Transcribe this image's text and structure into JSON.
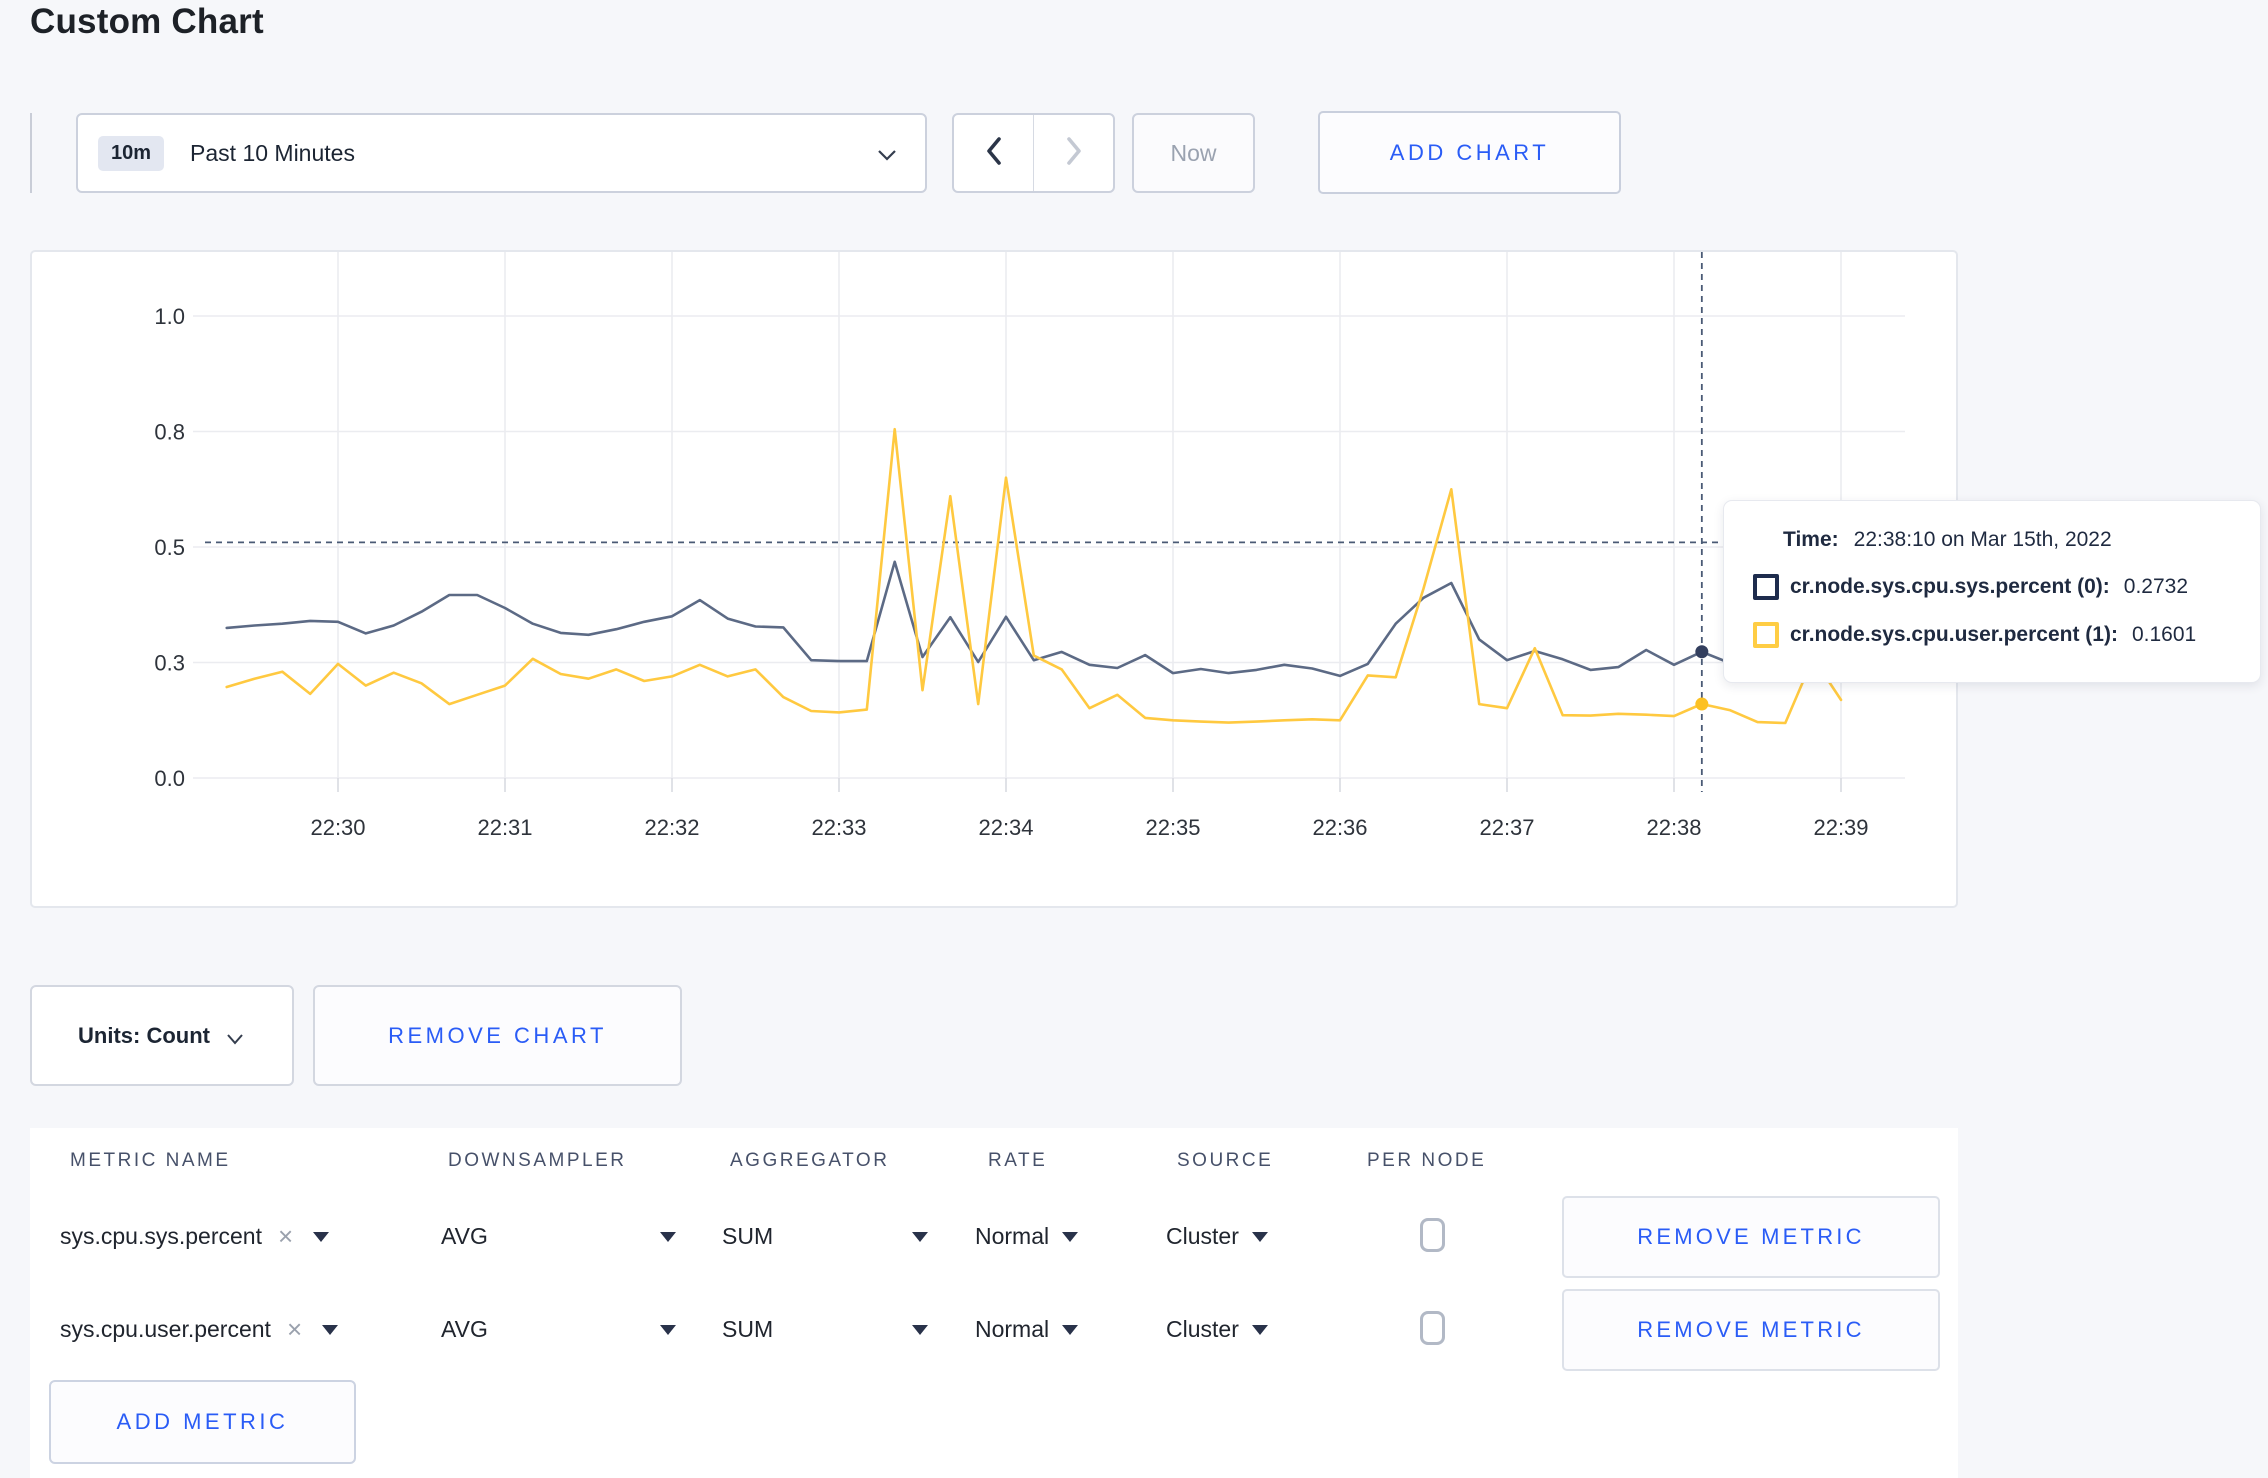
{
  "page": {
    "title": "Custom Chart"
  },
  "toolbar": {
    "time_window_badge": "10m",
    "time_window_label": "Past 10 Minutes",
    "now_label": "Now",
    "add_chart_label": "ADD CHART"
  },
  "chart_controls": {
    "units_label": "Units: Count",
    "remove_chart_label": "REMOVE CHART",
    "add_metric_label": "ADD METRIC"
  },
  "tooltip": {
    "time_label": "Time:",
    "time_value": "22:38:10 on Mar 15th, 2022",
    "series": [
      {
        "label": "cr.node.sys.cpu.sys.percent (0):",
        "value": "0.2732",
        "color": "#1e2c4d"
      },
      {
        "label": "cr.node.sys.cpu.user.percent (1):",
        "value": "0.1601",
        "color": "#ffcd44"
      }
    ]
  },
  "metrics_table": {
    "headers": [
      "METRIC NAME",
      "DOWNSAMPLER",
      "AGGREGATOR",
      "RATE",
      "SOURCE",
      "PER NODE"
    ],
    "rows": [
      {
        "metric": "sys.cpu.sys.percent",
        "remove_token": "×",
        "downsampler": "AVG",
        "aggregator": "SUM",
        "rate": "Normal",
        "source": "Cluster",
        "per_node_checked": false,
        "remove_label": "REMOVE METRIC"
      },
      {
        "metric": "sys.cpu.user.percent",
        "remove_token": "×",
        "downsampler": "AVG",
        "aggregator": "SUM",
        "rate": "Normal",
        "source": "Cluster",
        "per_node_checked": false,
        "remove_label": "REMOVE METRIC"
      }
    ]
  },
  "chart_data": {
    "type": "line",
    "title": "",
    "xlabel": "",
    "ylabel": "",
    "ylim": [
      0,
      1
    ],
    "grid": true,
    "x_start": "22:29:20",
    "x_step_seconds": 10,
    "x_ticks": [
      "22:30",
      "22:31",
      "22:32",
      "22:33",
      "22:34",
      "22:35",
      "22:36",
      "22:37",
      "22:38",
      "22:39"
    ],
    "y_ticks": [
      {
        "v": 0.0,
        "label": "0.0"
      },
      {
        "v": 0.25,
        "label": "0.3"
      },
      {
        "v": 0.5,
        "label": "0.5"
      },
      {
        "v": 0.75,
        "label": "0.8"
      },
      {
        "v": 1.0,
        "label": "1.0"
      }
    ],
    "series": [
      {
        "name": "cr.node.sys.cpu.sys.percent",
        "color": "#5c6a85",
        "dot_color": "#333f5e",
        "values": [
          0.325,
          0.33,
          0.334,
          0.34,
          0.338,
          0.313,
          0.33,
          0.36,
          0.396,
          0.396,
          0.368,
          0.334,
          0.314,
          0.31,
          0.322,
          0.338,
          0.35,
          0.385,
          0.345,
          0.328,
          0.326,
          0.255,
          0.253,
          0.253,
          0.468,
          0.262,
          0.348,
          0.251,
          0.349,
          0.255,
          0.273,
          0.245,
          0.238,
          0.266,
          0.227,
          0.236,
          0.227,
          0.234,
          0.245,
          0.237,
          0.221,
          0.247,
          0.334,
          0.39,
          0.422,
          0.3,
          0.255,
          0.275,
          0.257,
          0.234,
          0.24,
          0.277,
          0.245,
          0.2732,
          0.249,
          0.26,
          0.267,
          0.272,
          0.276
        ]
      },
      {
        "name": "cr.node.sys.cpu.user.percent",
        "color": "#ffc940",
        "dot_color": "#fcc123",
        "values": [
          0.197,
          0.215,
          0.23,
          0.182,
          0.247,
          0.2,
          0.228,
          0.205,
          0.16,
          0.18,
          0.2,
          0.258,
          0.225,
          0.215,
          0.235,
          0.21,
          0.22,
          0.245,
          0.22,
          0.235,
          0.175,
          0.145,
          0.142,
          0.148,
          0.755,
          0.19,
          0.61,
          0.16,
          0.65,
          0.265,
          0.235,
          0.151,
          0.18,
          0.13,
          0.125,
          0.122,
          0.12,
          0.122,
          0.125,
          0.127,
          0.125,
          0.222,
          0.218,
          0.41,
          0.625,
          0.16,
          0.151,
          0.281,
          0.136,
          0.135,
          0.139,
          0.137,
          0.134,
          0.1601,
          0.147,
          0.121,
          0.119,
          0.26,
          0.169
        ]
      }
    ],
    "crosshair": {
      "time": "22:38:10",
      "value": 0.51
    },
    "highlights": [
      {
        "series": 0,
        "time": "22:38:10",
        "value": 0.2732
      },
      {
        "series": 1,
        "time": "22:38:10",
        "value": 0.1601
      }
    ],
    "legend_position": "tooltip"
  }
}
